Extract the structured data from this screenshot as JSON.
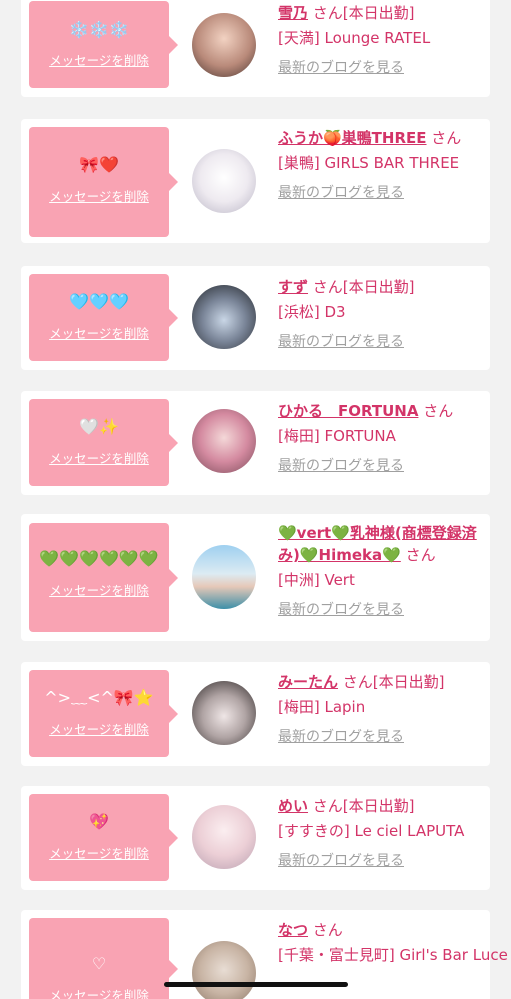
{
  "delete_label": "メッセージを削除",
  "blog_label": "最新のブログを見る",
  "items": [
    {
      "message": "❄️❄️❄️",
      "name": "雪乃",
      "suffix": "さん[本日出勤]",
      "shop": "[天満] Lounge RATEL"
    },
    {
      "message": "🎀❤️",
      "name": "ふうか🍑巣鴨THREE",
      "suffix": "さん",
      "shop": "[巣鴨] GIRLS BAR THREE"
    },
    {
      "message": "🩵🩵🩵",
      "name": "すず",
      "suffix": "さん[本日出勤]",
      "shop": "[浜松] D3"
    },
    {
      "message": "🤍✨",
      "name": "ひかる　FORTUNA",
      "suffix": "さん",
      "shop": "[梅田] FORTUNA"
    },
    {
      "message": "💚💚💚💚💚💚",
      "name": "💚vert💚乳神様(商標登録済み)💚Himeka💚",
      "suffix": "さん",
      "shop": "[中洲] Vert"
    },
    {
      "message": "^>﹏<^🎀⭐",
      "name": "みーたん",
      "suffix": "さん[本日出勤]",
      "shop": "[梅田] Lapin"
    },
    {
      "message": "💖",
      "name": "めい",
      "suffix": "さん[本日出勤]",
      "shop": "[すすきの] Le ciel LAPUTA"
    },
    {
      "message": "♡",
      "name": "なつ",
      "suffix": "さん",
      "shop": "[千葉・富士見町] Girl's Bar Luce"
    }
  ],
  "colors": {
    "accent": "#d33468",
    "bubble": "#f9a3b3",
    "link_gray": "#a0a0a0",
    "background": "#f2f2f2"
  }
}
